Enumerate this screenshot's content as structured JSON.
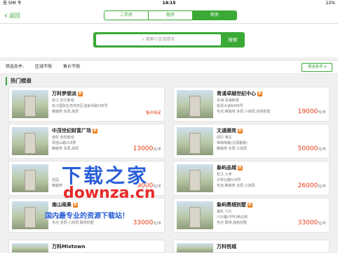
{
  "status_bar": {
    "carrier": "无 SIM 令",
    "time": "14:15",
    "battery": "22%"
  },
  "nav": {
    "back_label": "返回",
    "segments": [
      {
        "label": "二手房",
        "active": false
      },
      {
        "label": "租房",
        "active": false
      },
      {
        "label": "新房",
        "active": true
      }
    ]
  },
  "search": {
    "placeholder": "搜索小区或楼名",
    "button_label": "搜索"
  },
  "filter": {
    "label": "筛选条件:",
    "area": "区域不限",
    "price": "售价不限",
    "button_label": "筛选条件"
  },
  "section_title": "热门楼盘",
  "listings_left": [
    {
      "name": "万科梦想派",
      "badge": "折",
      "lines": [
        "松江 松江新城",
        "松江国际生态商务区谈家浜路188号",
        "精装修 多层,高层"
      ],
      "price": "售价待定",
      "price_unit": ""
    },
    {
      "name": "中茂世纪财富广场",
      "badge": "折",
      "lines": [
        "普陀 普陀新城",
        "祁连山路218弄",
        "精装修 多层,高层"
      ],
      "price": "13000",
      "price_unit": "元/平"
    },
    {
      "name": "",
      "badge": "",
      "lines": [
        "",
        "花园",
        "精装修"
      ],
      "price": "9000",
      "price_unit": "元/平"
    },
    {
      "name": "南山雨果",
      "badge": "折",
      "lines": [
        "",
        "上海市",
        "毛坯 多层,小高层,联排别墅"
      ],
      "price": "33000",
      "price_unit": "元/平"
    },
    {
      "name": "万科Mixtown",
      "badge": "",
      "lines": [],
      "price": "",
      "price_unit": ""
    }
  ],
  "listings_right": [
    {
      "name": "青浦卓越世纪中心",
      "badge": "折",
      "lines": [
        "青浦 青浦新城",
        "崧泽大道6066号",
        "毛坯,精装修 多层,小高层,双拼别墅"
      ],
      "price": "19000",
      "price_unit": "元/平"
    },
    {
      "name": "文通雅苑",
      "badge": "折",
      "lines": [
        "闵行 莘庄",
        "莘西南路(近顾戴路)",
        "精装修 多层,小高层"
      ],
      "price": "50000",
      "price_unit": "元/平"
    },
    {
      "name": "象屿品城",
      "badge": "折",
      "lines": [
        "松江 九亭",
        "沪亭北路518号",
        "毛坯,精装修 多层,小高层"
      ],
      "price": "26000",
      "price_unit": "元/平"
    },
    {
      "name": "象屿鼎城别墅",
      "badge": "折",
      "lines": [
        "浦东 川沙",
        "川沙路(中环)西北侧",
        "毛坯 联排,独栋别墅"
      ],
      "price": "33000",
      "price_unit": "元/平"
    },
    {
      "name": "万科悦城",
      "badge": "",
      "lines": [],
      "price": "",
      "price_unit": ""
    }
  ],
  "watermark": {
    "title": "下载之家",
    "url": "downza.cn",
    "tagline": "国内最专业的资源下载站！"
  },
  "colors": {
    "accent": "#3aa935",
    "price": "#e8380d",
    "badge": "#f07a17"
  }
}
